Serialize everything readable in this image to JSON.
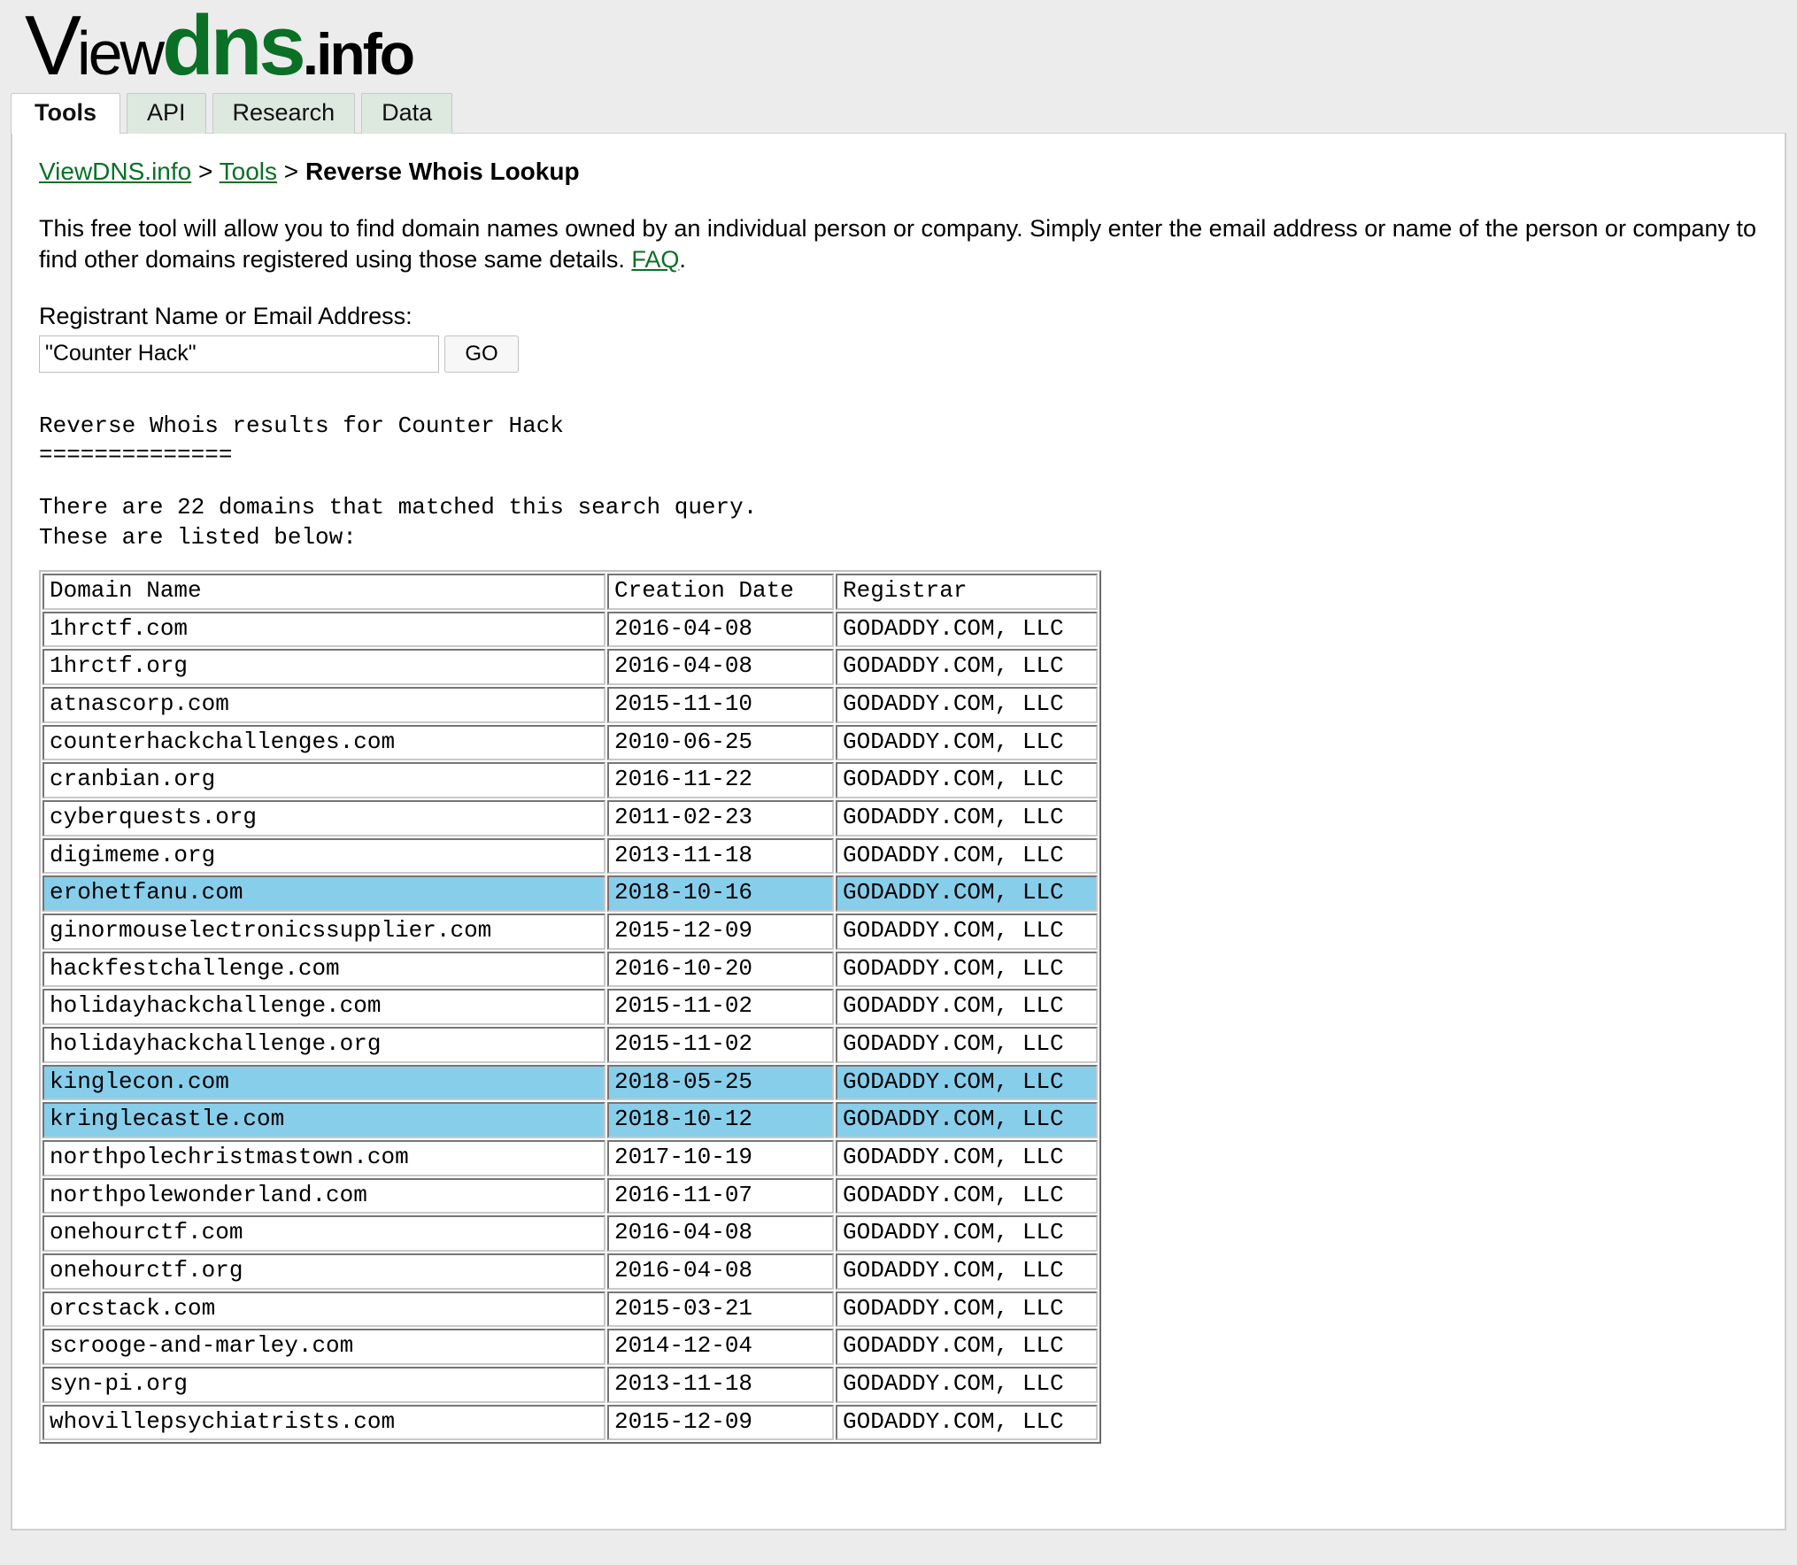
{
  "logo": {
    "part1": "V",
    "part2": "iew",
    "part3": "dns",
    "part4": ".info"
  },
  "tabs": [
    {
      "label": "Tools",
      "active": true
    },
    {
      "label": "API",
      "active": false
    },
    {
      "label": "Research",
      "active": false
    },
    {
      "label": "Data",
      "active": false
    }
  ],
  "breadcrumb": {
    "home": "ViewDNS.info",
    "sep1": " > ",
    "tools": "Tools",
    "sep2": " > ",
    "current": "Reverse Whois Lookup"
  },
  "intro": {
    "text_before": "This free tool will allow you to find domain names owned by an individual person or company. Simply enter the email address or name of the person or company to find other domains registered using those same details. ",
    "faq_link": "FAQ",
    "text_after": "."
  },
  "form": {
    "label": "Registrant Name or Email Address:",
    "input_value": "\"Counter Hack\"",
    "input_placeholder": "",
    "go_label": "GO"
  },
  "report": {
    "title_line": "Reverse Whois results for Counter Hack",
    "underline": "==============",
    "summary_line1": "There are 22 domains that matched this search query.",
    "summary_line2": "These are listed below:"
  },
  "colors": {
    "brand_green": "#0a7026",
    "highlight_blue": "#87ceeb",
    "page_background": "#ececec",
    "tab_inactive": "#dde8de"
  },
  "table": {
    "headers": [
      "Domain Name",
      "Creation Date",
      "Registrar"
    ],
    "rows": [
      {
        "domain": "1hrctf.com",
        "created": "2016-04-08",
        "registrar": "GODADDY.COM, LLC",
        "highlighted": false
      },
      {
        "domain": "1hrctf.org",
        "created": "2016-04-08",
        "registrar": "GODADDY.COM, LLC",
        "highlighted": false
      },
      {
        "domain": "atnascorp.com",
        "created": "2015-11-10",
        "registrar": "GODADDY.COM, LLC",
        "highlighted": false
      },
      {
        "domain": "counterhackchallenges.com",
        "created": "2010-06-25",
        "registrar": "GODADDY.COM, LLC",
        "highlighted": false
      },
      {
        "domain": "cranbian.org",
        "created": "2016-11-22",
        "registrar": "GODADDY.COM, LLC",
        "highlighted": false
      },
      {
        "domain": "cyberquests.org",
        "created": "2011-02-23",
        "registrar": "GODADDY.COM, LLC",
        "highlighted": false
      },
      {
        "domain": "digimeme.org",
        "created": "2013-11-18",
        "registrar": "GODADDY.COM, LLC",
        "highlighted": false
      },
      {
        "domain": "erohetfanu.com",
        "created": "2018-10-16",
        "registrar": "GODADDY.COM, LLC",
        "highlighted": true
      },
      {
        "domain": "ginormouselectronicssupplier.com",
        "created": "2015-12-09",
        "registrar": "GODADDY.COM, LLC",
        "highlighted": false
      },
      {
        "domain": "hackfestchallenge.com",
        "created": "2016-10-20",
        "registrar": "GODADDY.COM, LLC",
        "highlighted": false
      },
      {
        "domain": "holidayhackchallenge.com",
        "created": "2015-11-02",
        "registrar": "GODADDY.COM, LLC",
        "highlighted": false
      },
      {
        "domain": "holidayhackchallenge.org",
        "created": "2015-11-02",
        "registrar": "GODADDY.COM, LLC",
        "highlighted": false
      },
      {
        "domain": "kinglecon.com",
        "created": "2018-05-25",
        "registrar": "GODADDY.COM, LLC",
        "highlighted": true
      },
      {
        "domain": "kringlecastle.com",
        "created": "2018-10-12",
        "registrar": "GODADDY.COM, LLC",
        "highlighted": true
      },
      {
        "domain": "northpolechristmastown.com",
        "created": "2017-10-19",
        "registrar": "GODADDY.COM, LLC",
        "highlighted": false
      },
      {
        "domain": "northpolewonderland.com",
        "created": "2016-11-07",
        "registrar": "GODADDY.COM, LLC",
        "highlighted": false
      },
      {
        "domain": "onehourctf.com",
        "created": "2016-04-08",
        "registrar": "GODADDY.COM, LLC",
        "highlighted": false
      },
      {
        "domain": "onehourctf.org",
        "created": "2016-04-08",
        "registrar": "GODADDY.COM, LLC",
        "highlighted": false
      },
      {
        "domain": "orcstack.com",
        "created": "2015-03-21",
        "registrar": "GODADDY.COM, LLC",
        "highlighted": false
      },
      {
        "domain": "scrooge-and-marley.com",
        "created": "2014-12-04",
        "registrar": "GODADDY.COM, LLC",
        "highlighted": false
      },
      {
        "domain": "syn-pi.org",
        "created": "2013-11-18",
        "registrar": "GODADDY.COM, LLC",
        "highlighted": false
      },
      {
        "domain": "whovillepsychiatrists.com",
        "created": "2015-12-09",
        "registrar": "GODADDY.COM, LLC",
        "highlighted": false
      }
    ]
  }
}
